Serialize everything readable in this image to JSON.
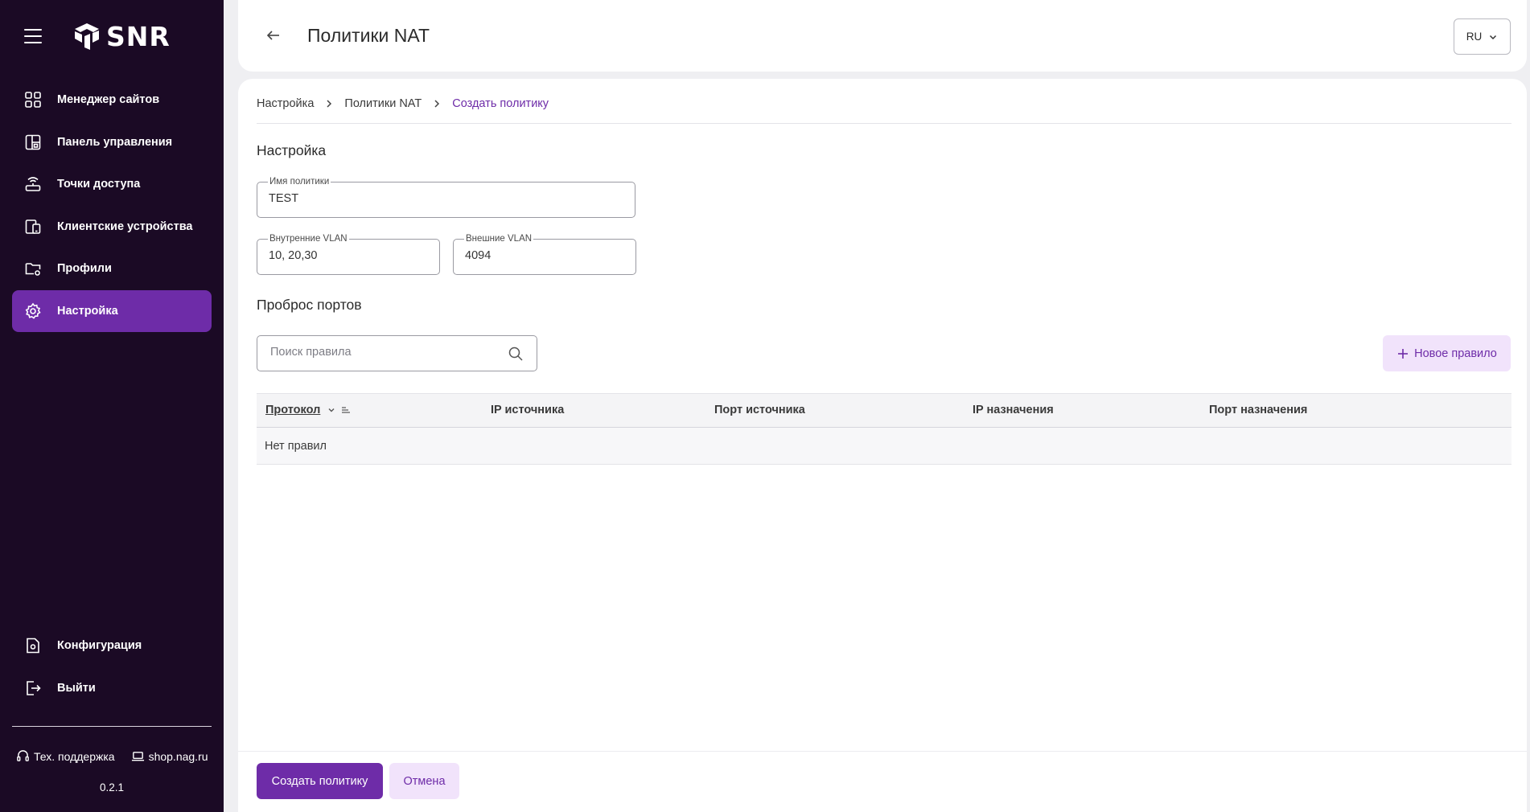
{
  "app": {
    "brand": "SNR",
    "version": "0.2.1"
  },
  "sidebar": {
    "items": [
      {
        "label": "Менеджер сайтов",
        "icon": "grid-icon",
        "active": false
      },
      {
        "label": "Панель управления",
        "icon": "dashboard-icon",
        "active": false
      },
      {
        "label": "Точки доступа",
        "icon": "access-point-icon",
        "active": false
      },
      {
        "label": "Клиентские устройства",
        "icon": "devices-icon",
        "active": false
      },
      {
        "label": "Профили",
        "icon": "folder-settings-icon",
        "active": false
      },
      {
        "label": "Настройка",
        "icon": "gear-icon",
        "active": true
      }
    ],
    "bottom_items": [
      {
        "label": "Конфигурация",
        "icon": "config-file-icon"
      },
      {
        "label": "Выйти",
        "icon": "logout-icon"
      }
    ],
    "footer": {
      "support_label": "Тех. поддержка",
      "shop_label": "shop.nag.ru"
    }
  },
  "header": {
    "title": "Политики NAT",
    "language": "RU"
  },
  "breadcrumb": {
    "items": [
      "Настройка",
      "Политики NAT",
      "Создать политику"
    ]
  },
  "form": {
    "section_title": "Настройка",
    "policy_name": {
      "label": "Имя политики",
      "value": "TEST"
    },
    "internal_vlan": {
      "label": "Внутренние VLAN",
      "value": "10, 20,30"
    },
    "external_vlan": {
      "label": "Внешние VLAN",
      "value": "4094"
    }
  },
  "port_forwarding": {
    "section_title": "Проброс портов",
    "search_placeholder": "Поиск правила",
    "new_rule_label": "Новое правило",
    "columns": [
      "Протокол",
      "IP источника",
      "Порт источника",
      "IP назначения",
      "Порт назначения"
    ],
    "empty_text": "Нет правил"
  },
  "actions": {
    "create_label": "Создать политику",
    "cancel_label": "Отмена"
  },
  "colors": {
    "sidebar_bg": "#1b0a25",
    "accent": "#6e2ca8",
    "accent_light": "#f1e3fb"
  }
}
